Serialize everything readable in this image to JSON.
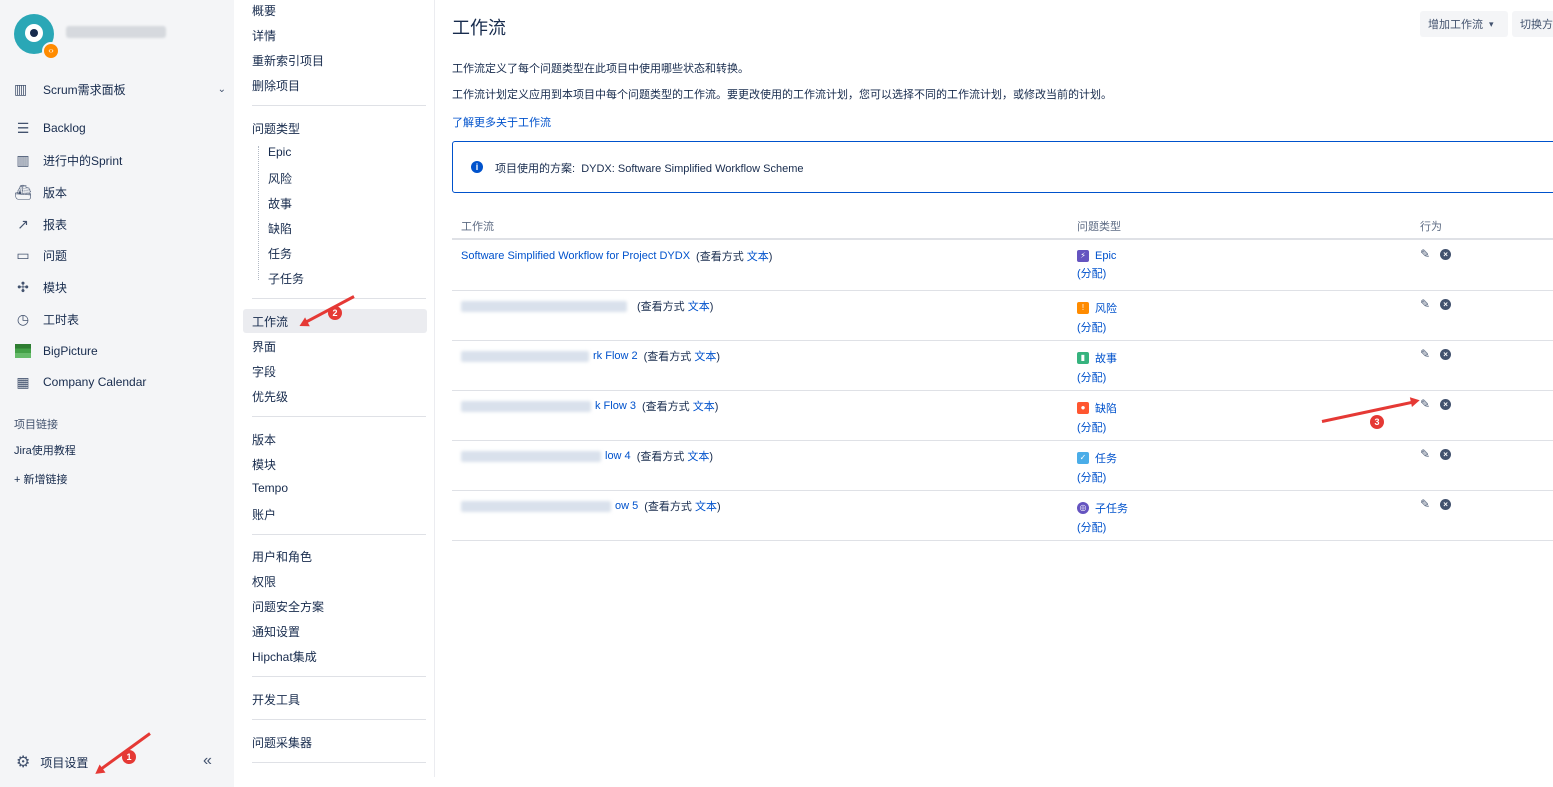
{
  "sidebar": {
    "board": "Scrum需求面板",
    "nav": [
      {
        "label": "Backlog",
        "icon": "backlog-icon"
      },
      {
        "label": "进行中的Sprint",
        "icon": "board-icon"
      },
      {
        "label": "版本",
        "icon": "ship-icon"
      },
      {
        "label": "报表",
        "icon": "chart-icon"
      },
      {
        "label": "问题",
        "icon": "issues-icon"
      },
      {
        "label": "模块",
        "icon": "puzzle-icon"
      },
      {
        "label": "工时表",
        "icon": "clock-icon"
      },
      {
        "label": "BigPicture",
        "icon": "bigpicture-icon"
      },
      {
        "label": "Company Calendar",
        "icon": "calendar-icon"
      }
    ],
    "links_title": "项目链接",
    "links": [
      "Jira使用教程",
      "+ 新增链接"
    ],
    "settings": "项目设置",
    "collapse": "«"
  },
  "subnav": {
    "group1": [
      "概要",
      "详情",
      "重新索引项目",
      "删除项目"
    ],
    "issue_types_title": "问题类型",
    "issue_types": [
      "Epic",
      "风险",
      "故事",
      "缺陷",
      "任务",
      "子任务"
    ],
    "group3": [
      "工作流",
      "界面",
      "字段",
      "优先级"
    ],
    "group4": [
      "版本",
      "模块",
      "Tempo",
      "账户"
    ],
    "group5": [
      "用户和角色",
      "权限",
      "问题安全方案",
      "通知设置",
      "Hipchat集成"
    ],
    "group6": [
      "开发工具"
    ],
    "group7": [
      "问题采集器"
    ]
  },
  "main": {
    "title": "工作流",
    "add_button": "增加工作流",
    "switch_button": "切换方",
    "desc1": "工作流定义了每个问题类型在此项目中使用哪些状态和转换。",
    "desc2": "工作流计划定义应用到本项目中每个问题类型的工作流。要更改使用的工作流计划，您可以选择不同的工作流计划，或修改当前的计划。",
    "learn_more": "了解更多关于工作流",
    "scheme_label": "项目使用的方案:",
    "scheme_name": "DYDX: Software Simplified Workflow Scheme",
    "columns": [
      "工作流",
      "问题类型",
      "行为"
    ],
    "view_prefix": "(查看方式",
    "view_link": "文本",
    "view_suffix": ")",
    "assign": "(分配)",
    "rows": [
      {
        "name": "Software Simplified Workflow for Project DYDX",
        "issue_type": "Epic",
        "color": "#6554c0",
        "glyph": "⚡"
      },
      {
        "name": "",
        "issue_type": "风险",
        "color": "#ff8b00",
        "glyph": "!"
      },
      {
        "name": "rk Flow 2",
        "issue_type": "故事",
        "color": "#36b37e",
        "glyph": "▮"
      },
      {
        "name": "k Flow 3",
        "issue_type": "缺陷",
        "color": "#ff5630",
        "glyph": "●"
      },
      {
        "name": "low 4",
        "issue_type": "任务",
        "color": "#4bade8",
        "glyph": "✓"
      },
      {
        "name": "ow 5",
        "issue_type": "子任务",
        "color": "#6554c0",
        "glyph": "◎"
      }
    ]
  },
  "annotations": [
    "1",
    "2",
    "3"
  ]
}
